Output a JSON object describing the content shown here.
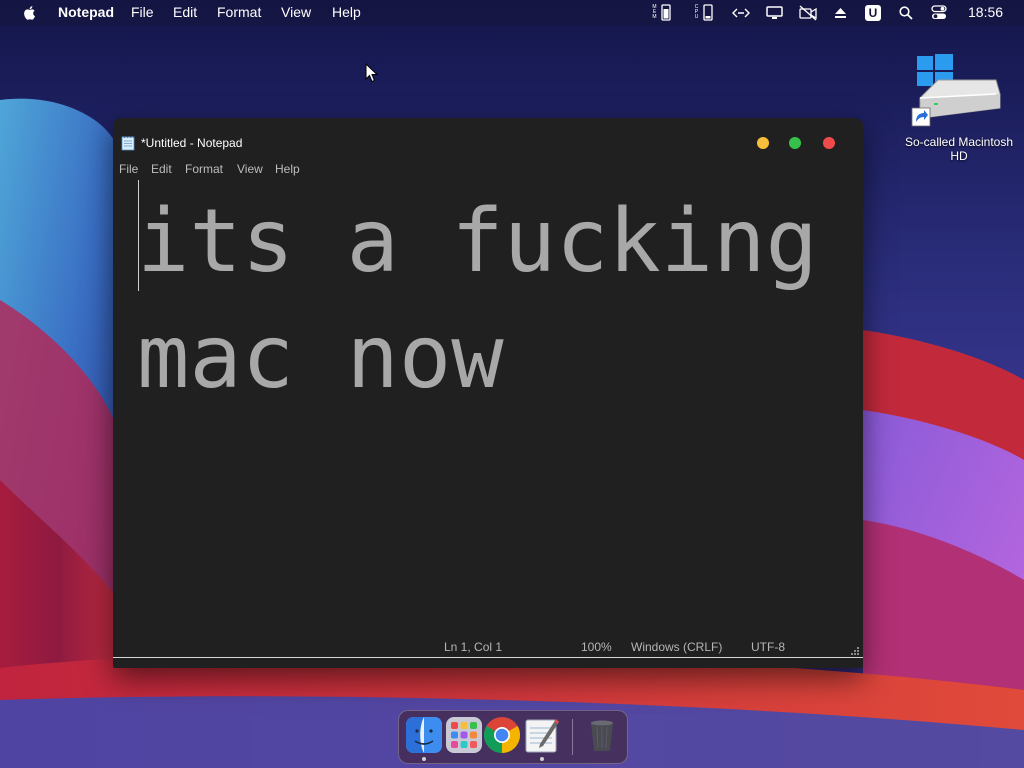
{
  "menubar": {
    "app_name": "Notepad",
    "menus": [
      "File",
      "Edit",
      "Format",
      "View",
      "Help"
    ],
    "tray_icons": [
      "mem-icon",
      "cpu-icon",
      "network-icon",
      "display-icon",
      "video-off-icon",
      "eject-icon",
      "u-badge-icon",
      "search-icon",
      "control-center-icon"
    ],
    "mem_label": "MEM",
    "cpu_label": "CPU",
    "u_badge": "U",
    "clock": "18:56"
  },
  "desktop_icon": {
    "label": "So-called Macintosh HD",
    "icon": "hard-drive-icon"
  },
  "window": {
    "title": "*Untitled - Notepad",
    "menus": [
      "File",
      "Edit",
      "Format",
      "View",
      "Help"
    ],
    "content": "its a fucking mac now",
    "status": {
      "position": "Ln 1, Col 1",
      "zoom": "100%",
      "line_ending": "Windows (CRLF)",
      "encoding": "UTF-8"
    }
  },
  "dock": {
    "apps": [
      {
        "name": "Finder",
        "running": true
      },
      {
        "name": "Launchpad",
        "running": false
      },
      {
        "name": "Google Chrome",
        "running": false
      },
      {
        "name": "Notepad",
        "running": true
      }
    ],
    "trash": "Trash"
  },
  "colors": {
    "window_bg": "#202020",
    "text": "#a8a8a8",
    "close": "#f04b4b",
    "minimize": "#f6be3a",
    "maximize": "#36c24a"
  }
}
